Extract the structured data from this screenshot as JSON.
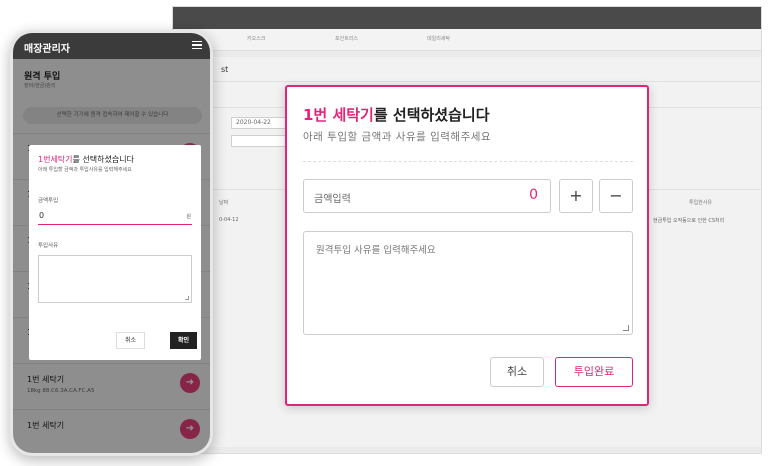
{
  "desktop": {
    "tabs": [
      "키오스크",
      "포인트리스",
      "데일리세탁"
    ],
    "content_title": "st",
    "date_value": "2020-04-22",
    "table_headers": [
      "날짜",
      "투입한사유"
    ],
    "table_cells": [
      "0-04-12",
      "현금투입 오작동으로 인한 CS처리"
    ]
  },
  "phone": {
    "app_title": "매장관리자",
    "section_title": "원격 투입",
    "section_subtitle": "장비(현금)관리",
    "notice": "선택한 기기에 원격 접속하여 제어할 수 있습니다",
    "items": [
      {
        "name": "1번 세탁기",
        "sub": "18kg  88.C6.3A.CA.FC.A5"
      },
      {
        "name": "1번 세탁기",
        "sub": ""
      }
    ],
    "partial_labels": [
      "1",
      "1",
      "1",
      "1",
      "1"
    ],
    "modal": {
      "title_highlight": "1번세탁기",
      "title_rest": "를 선택하셨습니다",
      "subtitle": "아래 투입할 금액과 투입사유를 입력해주세요",
      "amount_label": "금액투입",
      "amount_value": "0",
      "unit": "원",
      "reason_label": "투입사유",
      "cancel_label": "취소",
      "confirm_label": "확인"
    }
  },
  "dialog": {
    "title_highlight": "1번 세탁기",
    "title_rest": "를 선택하셨습니다",
    "subtitle": "아래 투입할 금액과 사유를 입력해주세요",
    "amount_placeholder": "금액입력",
    "amount_value": "0",
    "plus_label": "+",
    "minus_label": "−",
    "reason_placeholder": "원격투입 사유를 입력해주세요",
    "cancel_label": "취소",
    "submit_label": "투입완료"
  },
  "colors": {
    "accent": "#e0267a",
    "arrow": "#e8407f",
    "header": "#3b3b3b"
  },
  "icons": [
    "menu-icon",
    "arrow-right-icon",
    "plus-icon",
    "minus-icon",
    "resize-grip-icon"
  ]
}
